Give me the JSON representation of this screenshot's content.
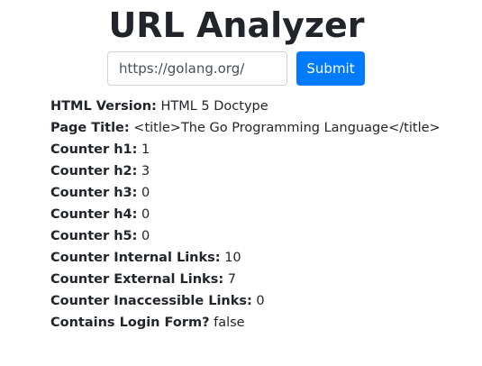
{
  "header": {
    "title": "URL Analyzer"
  },
  "form": {
    "url_value": "https://golang.org/",
    "submit_label": "Submit"
  },
  "results": [
    {
      "label": "HTML Version:",
      "value": "HTML 5 Doctype"
    },
    {
      "label": "Page Title:",
      "value": "<title>The Go Programming Language</title>"
    },
    {
      "label": "Counter h1:",
      "value": "1"
    },
    {
      "label": "Counter h2:",
      "value": "3"
    },
    {
      "label": "Counter h3:",
      "value": "0"
    },
    {
      "label": "Counter h4:",
      "value": "0"
    },
    {
      "label": "Counter h5:",
      "value": "0"
    },
    {
      "label": "Counter Internal Links:",
      "value": "10"
    },
    {
      "label": "Counter External Links:",
      "value": "7"
    },
    {
      "label": "Counter Inaccessible Links:",
      "value": "0"
    },
    {
      "label": "Contains Login Form?",
      "value": "false"
    }
  ],
  "colors": {
    "primary": "#007bff",
    "text": "#212529",
    "input_border": "#ced4da"
  }
}
